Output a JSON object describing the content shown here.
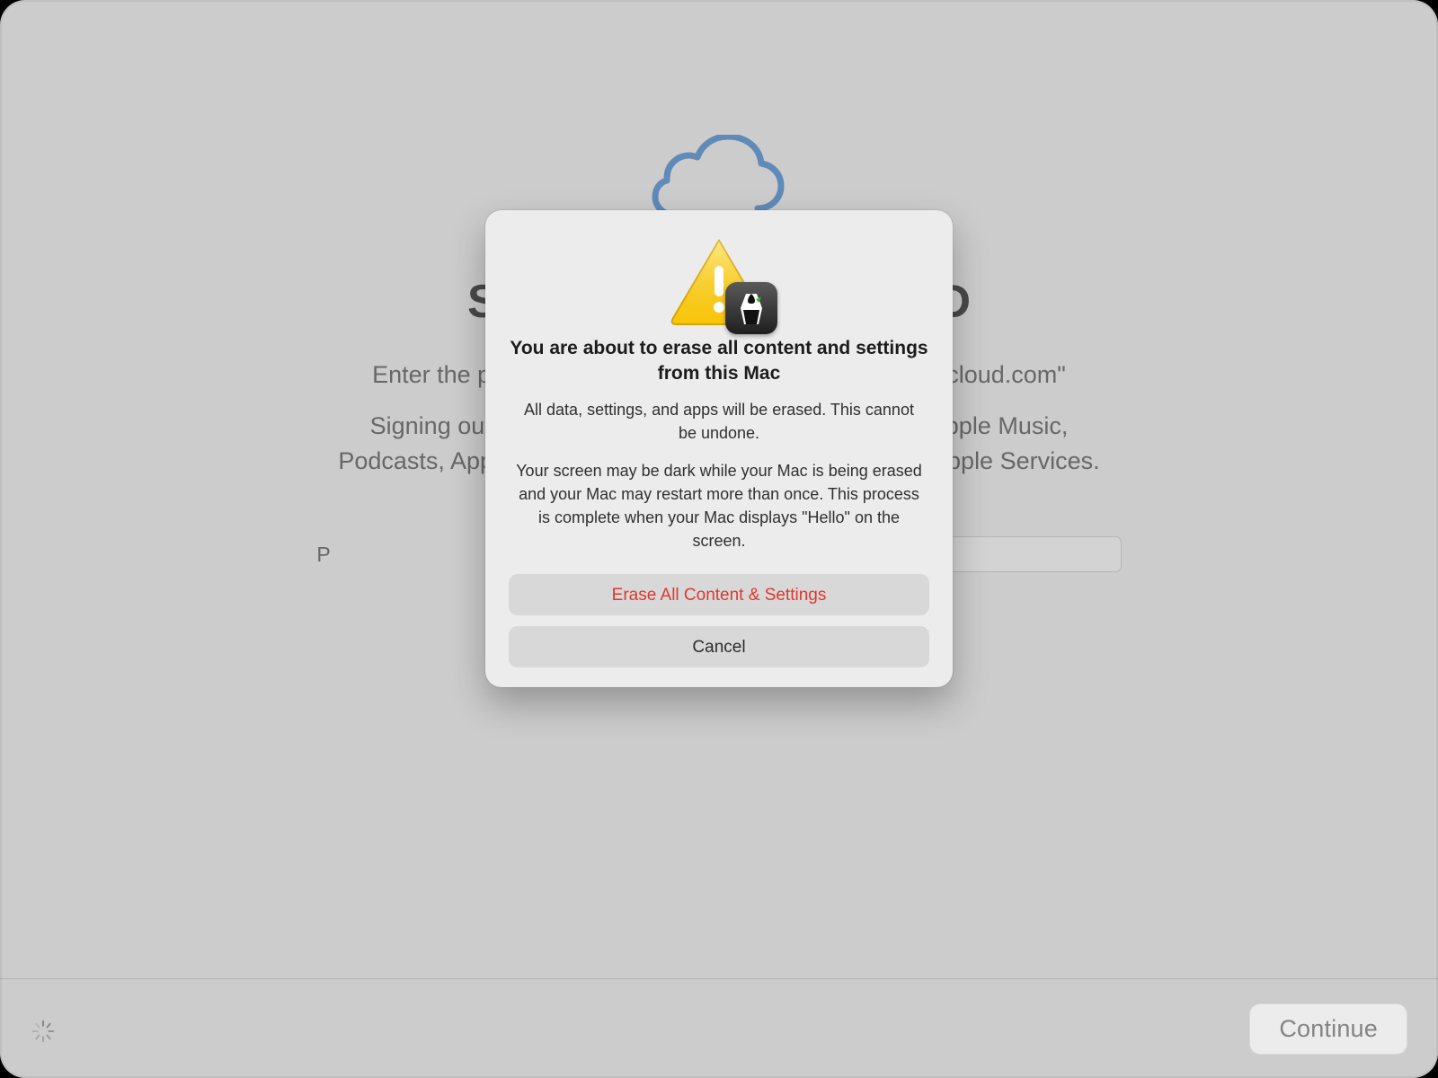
{
  "background": {
    "title_fragment_left": "Si",
    "title_fragment_right": "ID",
    "subtitle1_left": "Enter the p",
    "subtitle1_right": "cloud.com\"",
    "subtitle2_line1_left": "Signing out",
    "subtitle2_line1_right": "pple Music,",
    "subtitle2_line2_left": "Podcasts, App",
    "subtitle2_line2_right": "pple Services.",
    "password_label_fragment": "P"
  },
  "bottom_bar": {
    "continue_label": "Continue"
  },
  "alert": {
    "title": "You are about to erase all content and settings from this Mac",
    "body1": "All data, settings, and apps will be erased. This cannot be undone.",
    "body2": "Your screen may be dark while your Mac is being erased and your Mac may restart more than once. This process is complete when your Mac displays \"Hello\" on the screen.",
    "erase_button": "Erase All Content & Settings",
    "cancel_button": "Cancel"
  },
  "colors": {
    "destructive": "#e0372f",
    "cloud_stroke": "#4f8fd4"
  }
}
